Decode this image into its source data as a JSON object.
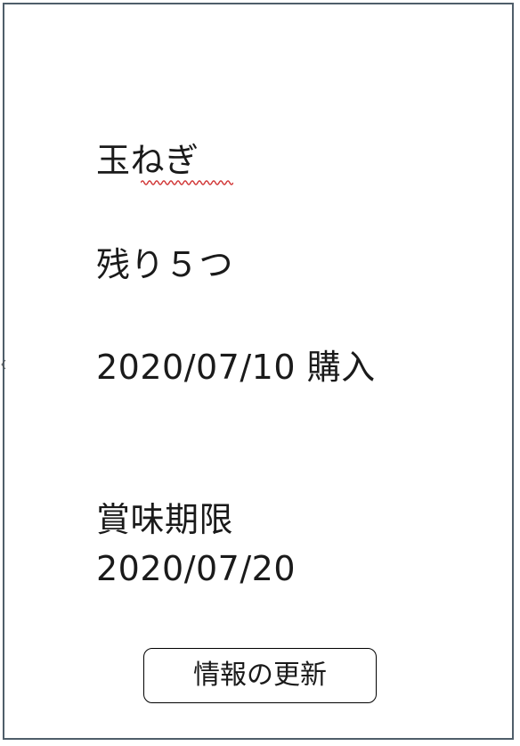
{
  "item": {
    "name": "玉ねぎ",
    "remaining": "残り５つ",
    "purchase": "2020/07/10 購入",
    "expiry_label": "賞味期限",
    "expiry_date": "2020/07/20"
  },
  "actions": {
    "update_label": "情報の更新"
  },
  "colors": {
    "frame_border": "#4f5e6a",
    "spellcheck_underline": "#d23a3a"
  }
}
